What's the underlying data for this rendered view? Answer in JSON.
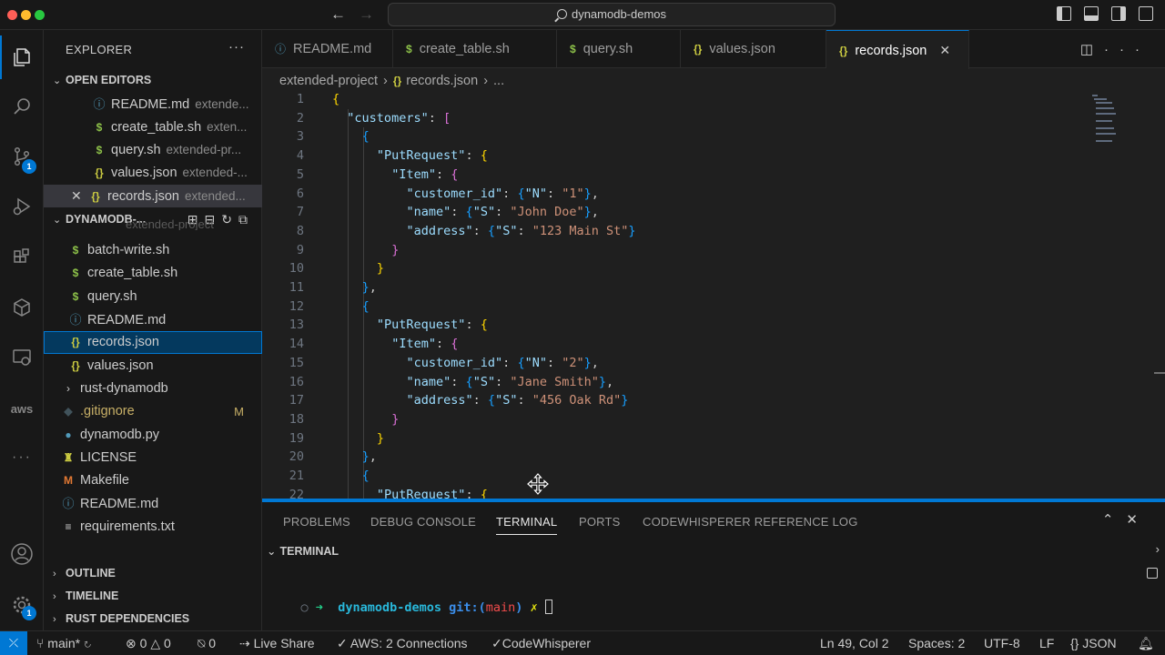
{
  "window": {
    "title": "dynamodb-demos"
  },
  "activity_bar": {
    "scm_badge": "1",
    "settings_badge": "1"
  },
  "sidebar": {
    "title": "EXPLORER",
    "more": "···",
    "open_editors_title": "OPEN EDITORS",
    "open_editors": [
      {
        "icon": "info",
        "name": "README.md",
        "desc": "extende..."
      },
      {
        "icon": "$",
        "name": "create_table.sh",
        "desc": "exten..."
      },
      {
        "icon": "$",
        "name": "query.sh",
        "desc": "extended-pr..."
      },
      {
        "icon": "{}",
        "name": "values.json",
        "desc": "extended-..."
      },
      {
        "icon": "{}",
        "name": "records.json",
        "desc": "extended..."
      }
    ],
    "project_title": "DYNAMODB-...",
    "partial_folder": "extended-project",
    "files": [
      {
        "icon": "$",
        "name": "batch-write.sh"
      },
      {
        "icon": "$",
        "name": "create_table.sh"
      },
      {
        "icon": "$",
        "name": "query.sh"
      },
      {
        "icon": "info",
        "name": "README.md"
      },
      {
        "icon": "{}",
        "name": "records.json"
      },
      {
        "icon": "{}",
        "name": "values.json"
      }
    ],
    "root_items": [
      {
        "icon": "chevron",
        "name": "rust-dynamodb",
        "badge": ""
      },
      {
        "icon": "git",
        "name": ".gitignore",
        "badge": "M"
      },
      {
        "icon": "py",
        "name": "dynamodb.py",
        "badge": ""
      },
      {
        "icon": "license",
        "name": "LICENSE",
        "badge": ""
      },
      {
        "icon": "M",
        "name": "Makefile",
        "badge": ""
      },
      {
        "icon": "info",
        "name": "README.md",
        "badge": ""
      },
      {
        "icon": "lines",
        "name": "requirements.txt",
        "badge": ""
      }
    ],
    "bottom_sections": [
      "OUTLINE",
      "TIMELINE",
      "RUST DEPENDENCIES"
    ]
  },
  "tabs": [
    {
      "icon": "info",
      "label": "README.md"
    },
    {
      "icon": "$",
      "label": "create_table.sh"
    },
    {
      "icon": "$",
      "label": "query.sh"
    },
    {
      "icon": "{}",
      "label": "values.json"
    },
    {
      "icon": "{}",
      "label": "records.json",
      "active": true
    }
  ],
  "breadcrumb": {
    "folder": "extended-project",
    "file": "records.json",
    "more": "..."
  },
  "code_lines": [
    {
      "n": "1",
      "indent": 0,
      "tokens": [
        [
          "b1",
          "{"
        ]
      ]
    },
    {
      "n": "2",
      "indent": 1,
      "tokens": [
        [
          "k",
          "\"customers\""
        ],
        [
          "p",
          ": "
        ],
        [
          "b2",
          "["
        ]
      ]
    },
    {
      "n": "3",
      "indent": 2,
      "tokens": [
        [
          "b3",
          "{"
        ]
      ]
    },
    {
      "n": "4",
      "indent": 3,
      "tokens": [
        [
          "k",
          "\"PutRequest\""
        ],
        [
          "p",
          ": "
        ],
        [
          "b1",
          "{"
        ]
      ]
    },
    {
      "n": "5",
      "indent": 4,
      "tokens": [
        [
          "k",
          "\"Item\""
        ],
        [
          "p",
          ": "
        ],
        [
          "b2",
          "{"
        ]
      ]
    },
    {
      "n": "6",
      "indent": 5,
      "tokens": [
        [
          "k",
          "\"customer_id\""
        ],
        [
          "p",
          ": "
        ],
        [
          "b3",
          "{"
        ],
        [
          "k",
          "\"N\""
        ],
        [
          "p",
          ": "
        ],
        [
          "s",
          "\"1\""
        ],
        [
          "b3",
          "}"
        ],
        [
          "p",
          ","
        ]
      ]
    },
    {
      "n": "7",
      "indent": 5,
      "tokens": [
        [
          "k",
          "\"name\""
        ],
        [
          "p",
          ": "
        ],
        [
          "b3",
          "{"
        ],
        [
          "k",
          "\"S\""
        ],
        [
          "p",
          ": "
        ],
        [
          "s",
          "\"John Doe\""
        ],
        [
          "b3",
          "}"
        ],
        [
          "p",
          ","
        ]
      ]
    },
    {
      "n": "8",
      "indent": 5,
      "tokens": [
        [
          "k",
          "\"address\""
        ],
        [
          "p",
          ": "
        ],
        [
          "b3",
          "{"
        ],
        [
          "k",
          "\"S\""
        ],
        [
          "p",
          ": "
        ],
        [
          "s",
          "\"123 Main St\""
        ],
        [
          "b3",
          "}"
        ]
      ]
    },
    {
      "n": "9",
      "indent": 4,
      "tokens": [
        [
          "b2",
          "}"
        ]
      ]
    },
    {
      "n": "10",
      "indent": 3,
      "tokens": [
        [
          "b1",
          "}"
        ]
      ]
    },
    {
      "n": "11",
      "indent": 2,
      "tokens": [
        [
          "b3",
          "}"
        ],
        [
          "p",
          ","
        ]
      ]
    },
    {
      "n": "12",
      "indent": 2,
      "tokens": [
        [
          "b3",
          "{"
        ]
      ]
    },
    {
      "n": "13",
      "indent": 3,
      "tokens": [
        [
          "k",
          "\"PutRequest\""
        ],
        [
          "p",
          ": "
        ],
        [
          "b1",
          "{"
        ]
      ]
    },
    {
      "n": "14",
      "indent": 4,
      "tokens": [
        [
          "k",
          "\"Item\""
        ],
        [
          "p",
          ": "
        ],
        [
          "b2",
          "{"
        ]
      ]
    },
    {
      "n": "15",
      "indent": 5,
      "tokens": [
        [
          "k",
          "\"customer_id\""
        ],
        [
          "p",
          ": "
        ],
        [
          "b3",
          "{"
        ],
        [
          "k",
          "\"N\""
        ],
        [
          "p",
          ": "
        ],
        [
          "s",
          "\"2\""
        ],
        [
          "b3",
          "}"
        ],
        [
          "p",
          ","
        ]
      ]
    },
    {
      "n": "16",
      "indent": 5,
      "tokens": [
        [
          "k",
          "\"name\""
        ],
        [
          "p",
          ": "
        ],
        [
          "b3",
          "{"
        ],
        [
          "k",
          "\"S\""
        ],
        [
          "p",
          ": "
        ],
        [
          "s",
          "\"Jane Smith\""
        ],
        [
          "b3",
          "}"
        ],
        [
          "p",
          ","
        ]
      ]
    },
    {
      "n": "17",
      "indent": 5,
      "tokens": [
        [
          "k",
          "\"address\""
        ],
        [
          "p",
          ": "
        ],
        [
          "b3",
          "{"
        ],
        [
          "k",
          "\"S\""
        ],
        [
          "p",
          ": "
        ],
        [
          "s",
          "\"456 Oak Rd\""
        ],
        [
          "b3",
          "}"
        ]
      ]
    },
    {
      "n": "18",
      "indent": 4,
      "tokens": [
        [
          "b2",
          "}"
        ]
      ]
    },
    {
      "n": "19",
      "indent": 3,
      "tokens": [
        [
          "b1",
          "}"
        ]
      ]
    },
    {
      "n": "20",
      "indent": 2,
      "tokens": [
        [
          "b3",
          "}"
        ],
        [
          "p",
          ","
        ]
      ]
    },
    {
      "n": "21",
      "indent": 2,
      "tokens": [
        [
          "b3",
          "{"
        ]
      ]
    },
    {
      "n": "22",
      "indent": 3,
      "tokens": [
        [
          "k",
          "\"PutRequest\""
        ],
        [
          "p",
          ": "
        ],
        [
          "b1",
          "{"
        ]
      ]
    }
  ],
  "panel": {
    "tabs": [
      "PROBLEMS",
      "DEBUG CONSOLE",
      "TERMINAL",
      "PORTS",
      "CODEWHISPERER REFERENCE LOG"
    ],
    "active_tab": "TERMINAL",
    "section_title": "TERMINAL",
    "prompt": {
      "dir": "dynamodb-demos",
      "git_label": "git:(",
      "branch": "main",
      "git_close": ")",
      "dirty": "✗"
    }
  },
  "statusbar": {
    "branch": "main*",
    "errors": "0",
    "warnings": "0",
    "ports": "0",
    "live_share": "Live Share",
    "aws": "AWS: 2 Connections",
    "codewhisperer": "CodeWhisperer",
    "position": "Ln 49, Col 2",
    "spaces": "Spaces: 2",
    "encoding": "UTF-8",
    "eol": "LF",
    "language": "JSON"
  }
}
